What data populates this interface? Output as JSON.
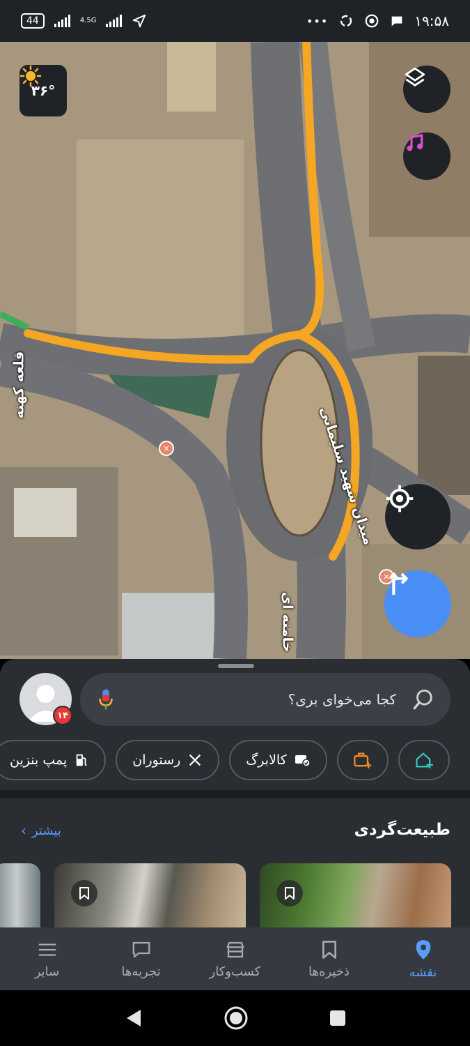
{
  "status_bar": {
    "battery": "44",
    "network_type": "4.5G",
    "time": "۱۹:۵۸",
    "more_dots": "•••"
  },
  "map": {
    "weather": {
      "temperature": "۳۶°",
      "icon": "sun-icon"
    },
    "labels": {
      "square": "میدان شهید سلیمانی",
      "street_left": "قلعه کهنه",
      "street_bottom": "خامنه ای"
    },
    "route_color": "#f5a623",
    "buttons": {
      "layers": "layers-icon",
      "music": "music-icon",
      "locate": "my-location-icon",
      "directions": "directions-icon"
    }
  },
  "search": {
    "placeholder": "کجا می‌خوای بری؟",
    "avatar_badge": "۱۴"
  },
  "chips": [
    {
      "label": "پمپ بنزین",
      "icon": "fuel-icon"
    },
    {
      "label": "رستوران",
      "icon": "restaurant-icon"
    },
    {
      "label": "کالابرگ",
      "icon": "voucher-icon"
    },
    {
      "label": "",
      "icon": "add-work-icon"
    },
    {
      "label": "",
      "icon": "add-home-icon"
    }
  ],
  "section": {
    "title": "طبیعت‌گردی",
    "more": "بیشتر"
  },
  "bottom_nav": [
    {
      "label": "نقشه",
      "icon": "map-pin-icon",
      "active": true
    },
    {
      "label": "ذخیره‌ها",
      "icon": "bookmark-icon",
      "active": false
    },
    {
      "label": "کسب‌وکار",
      "icon": "store-icon",
      "active": false
    },
    {
      "label": "تجربه‌ها",
      "icon": "chat-icon",
      "active": false
    },
    {
      "label": "سایر",
      "icon": "menu-icon",
      "active": false
    }
  ],
  "colors": {
    "accent": "#5a9cf8",
    "route": "#f5a623",
    "badge": "#e53935"
  }
}
